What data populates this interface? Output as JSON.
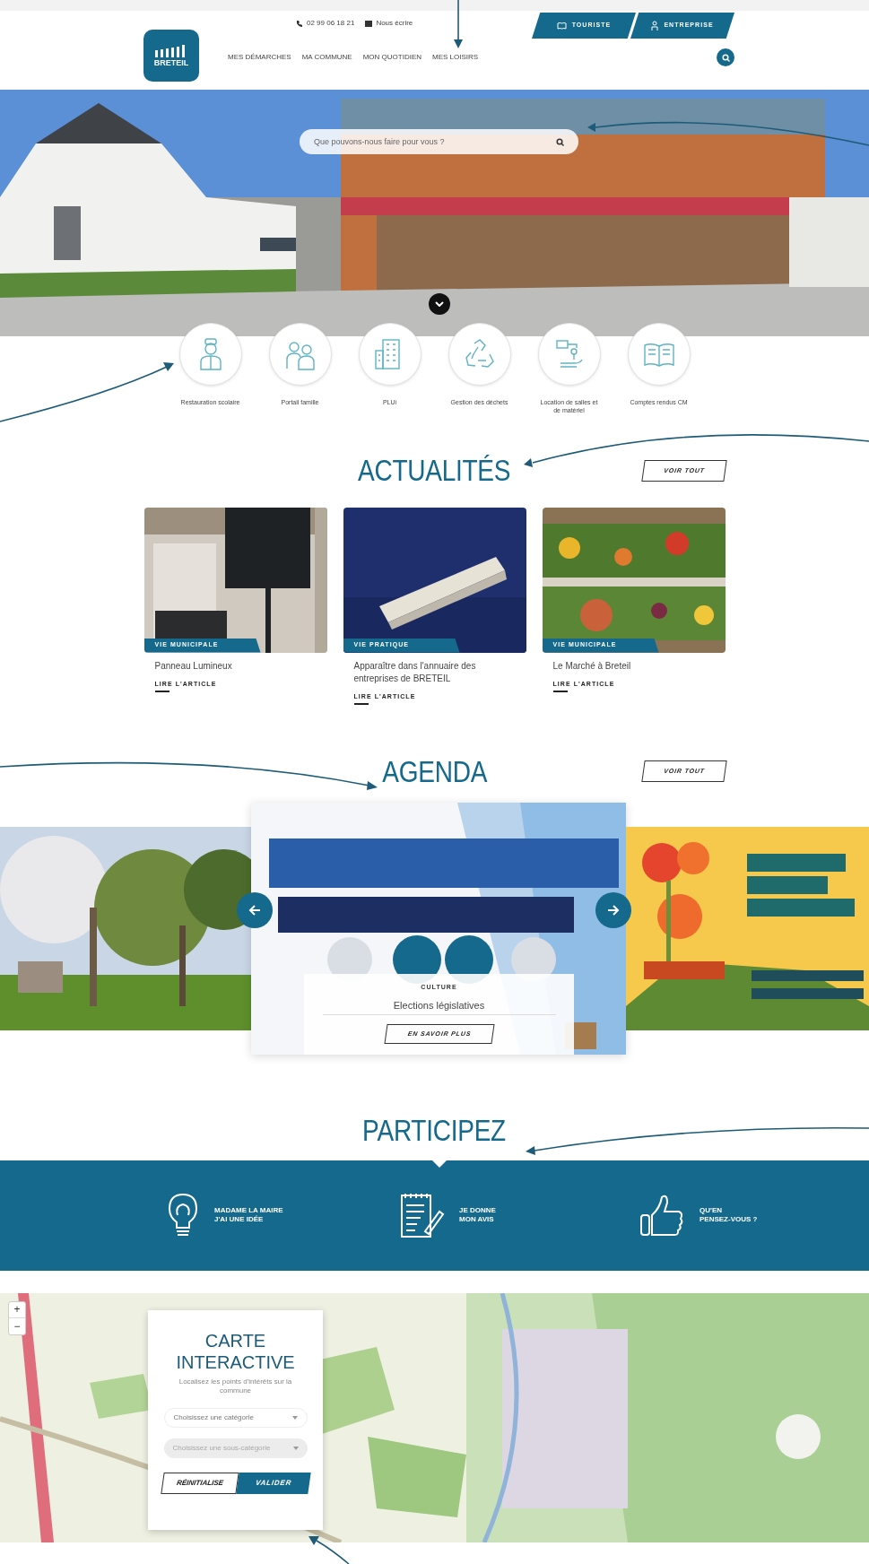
{
  "header": {
    "phone": "02 99 06 18 21",
    "email_link": "Nous écrire",
    "logo_text": "BRETEIL",
    "audience_tabs": [
      {
        "label": "TOURISTE"
      },
      {
        "label": "ENTREPRISE"
      }
    ],
    "nav": [
      "MES DÉMARCHES",
      "MA COMMUNE",
      "MON QUOTIDIEN",
      "MES LOISIRS"
    ]
  },
  "hero": {
    "search": {
      "placeholder": "Que pouvons-nous faire pour vous ?"
    }
  },
  "quick_links": [
    {
      "label": "Restauration scolaire"
    },
    {
      "label": "Portail famille"
    },
    {
      "label": "PLUi"
    },
    {
      "label": "Gestion des déchets"
    },
    {
      "label": "Location de salles et de matériel"
    },
    {
      "label": "Comptes rendus CM"
    }
  ],
  "news": {
    "title": "ACTUALITÉS",
    "see_all": "VOIR TOUT",
    "articles": [
      {
        "category": "VIE MUNICIPALE",
        "title": "Panneau Lumineux",
        "link": "LIRE L'ARTICLE"
      },
      {
        "category": "VIE PRATIQUE",
        "title": "Apparaître dans l'annuaire des entreprises de BRETEIL",
        "link": "LIRE L'ARTICLE"
      },
      {
        "category": "VIE MUNICIPALE",
        "title": "Le Marché à Breteil",
        "link": "LIRE L'ARTICLE"
      }
    ]
  },
  "agenda": {
    "title": "AGENDA",
    "see_all": "VOIR TOUT",
    "featured": {
      "category": "CULTURE",
      "title": "Elections législatives",
      "button": "EN SAVOIR PLUS"
    }
  },
  "participate": {
    "title": "PARTICIPEZ",
    "items": [
      {
        "text": "MADAME LA MAIRE\nJ'AI UNE IDÉE"
      },
      {
        "text": "JE DONNE\nMON AVIS"
      },
      {
        "text": "QU'EN\nPENSEZ-VOUS ?"
      }
    ]
  },
  "map": {
    "zoom_in": "+",
    "zoom_out": "−",
    "panel": {
      "title": "CARTE INTERACTIVE",
      "subtitle": "Localisez les points d'intérêts sur la commune",
      "selects": [
        {
          "placeholder": "Choisissez une catégorie",
          "disabled": false
        },
        {
          "placeholder": "Choisissez une sous-catégorie",
          "disabled": true
        }
      ],
      "reset": "RÉINITIALISE",
      "submit": "VALIDER"
    }
  }
}
